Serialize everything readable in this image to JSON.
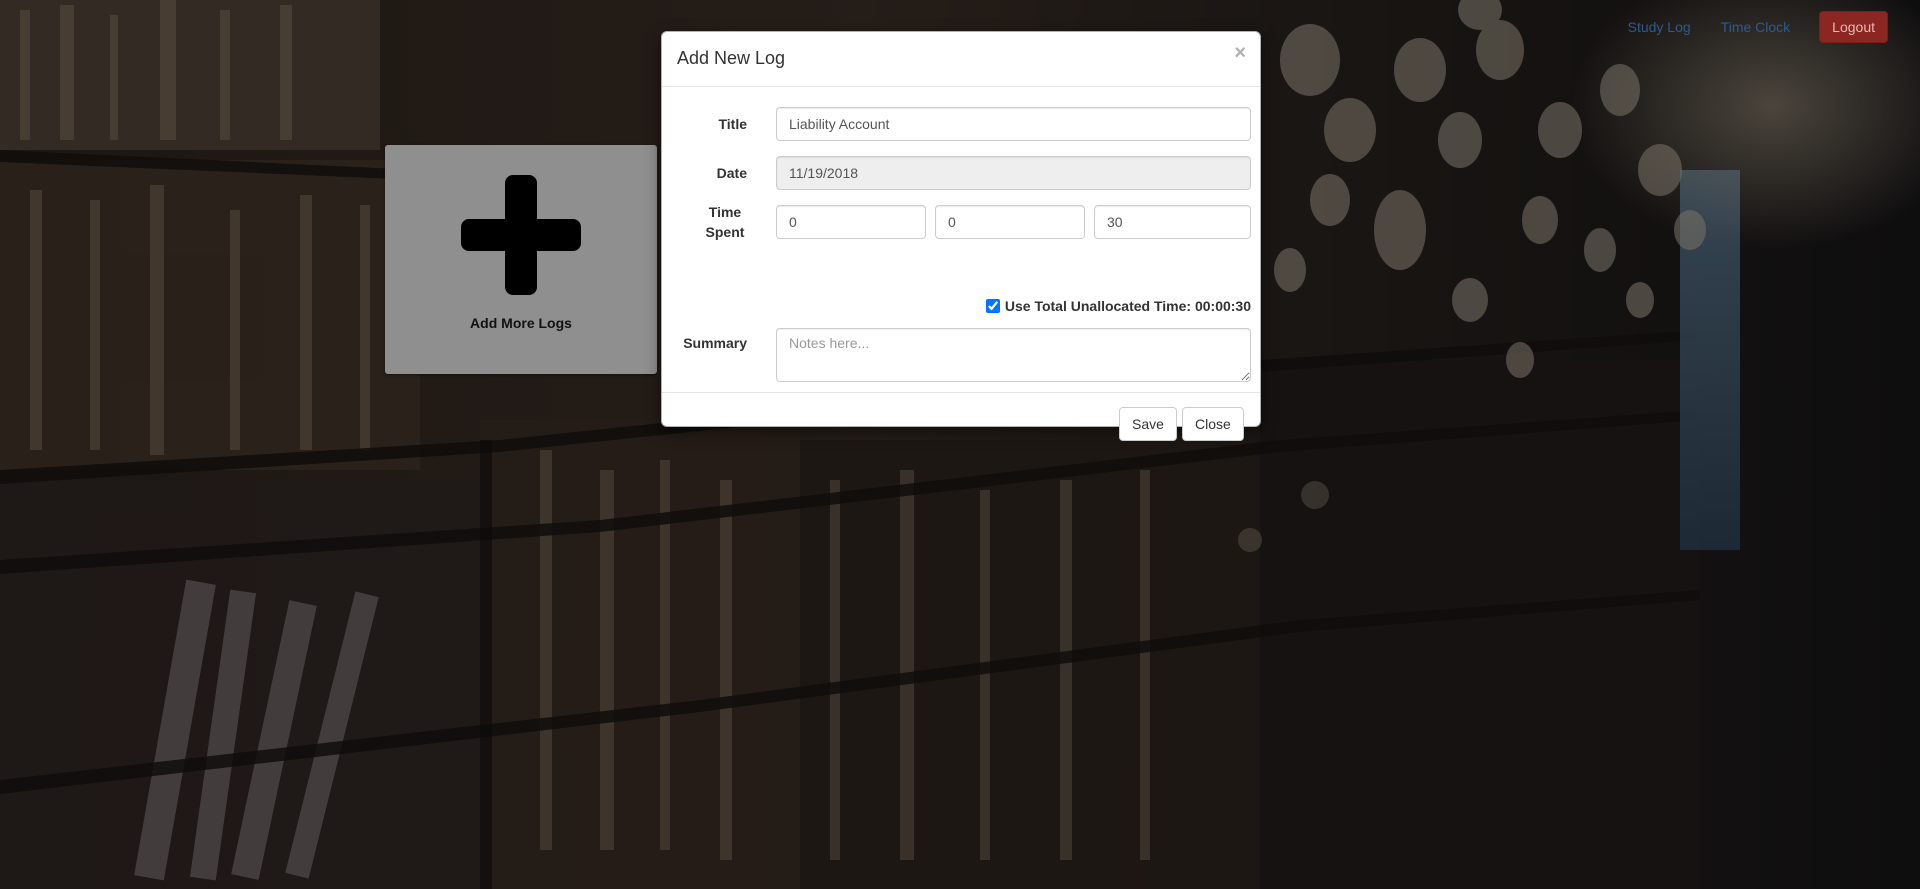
{
  "nav": {
    "study_log": "Study Log",
    "time_clock": "Time Clock",
    "logout": "Logout"
  },
  "add_card": {
    "label": "Add More Logs",
    "icon": "plus-icon"
  },
  "modal": {
    "title": "Add New Log",
    "close_glyph": "×",
    "fields": {
      "title_label": "Title",
      "title_value": "Liability Account",
      "date_label": "Date",
      "date_value": "11/19/2018",
      "time_label": "Time Spent",
      "hours_value": "0",
      "minutes_value": "0",
      "seconds_value": "30",
      "unallocated_label": "Use Total Unallocated Time: 00:00:30",
      "unallocated_checked": true,
      "summary_label": "Summary",
      "summary_placeholder": "Notes here..."
    },
    "footer": {
      "save": "Save",
      "close": "Close"
    }
  },
  "colors": {
    "logout_bg": "#8c2622",
    "nav_link": "#2d5a8f",
    "card_bg": "#8f8f8f"
  }
}
